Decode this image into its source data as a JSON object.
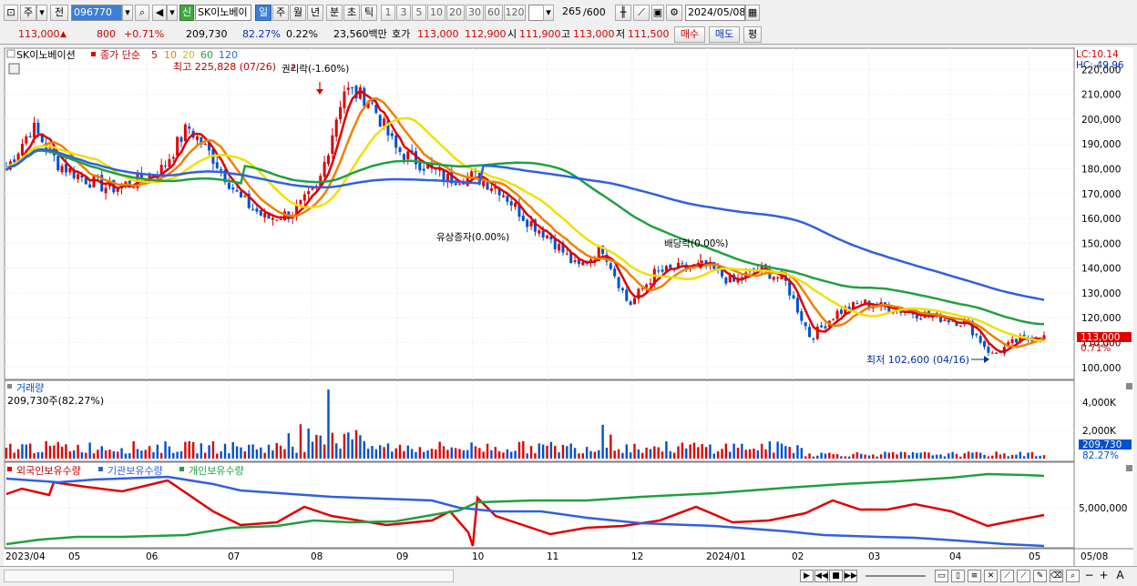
{
  "toolbar": {
    "period_unit": "주",
    "prev_label": "전",
    "code": "096770",
    "badge": "신",
    "stock_name": "SK이노베이",
    "intervals": [
      "일",
      "주",
      "월",
      "년",
      "분",
      "초",
      "틱"
    ],
    "selected_interval": "일",
    "counts": [
      "1",
      "3",
      "5",
      "10",
      "20",
      "30",
      "60",
      "120"
    ],
    "bar_count": "265",
    "bar_total": "/600",
    "date": "2024/05/08"
  },
  "quote": {
    "price": "113,000",
    "change": "800",
    "change_pct": "+0.71%",
    "volume": "209,730",
    "vol_ratio": "82.27%",
    "turnover_pct": "0.22%",
    "amount": "23,560백만",
    "hoga_label": "호가",
    "ask": "113,000",
    "bid": "112,900",
    "open_label": "시",
    "open": "111,900",
    "high_label": "고",
    "high": "113,000",
    "low_label": "저",
    "low": "111,500",
    "buy_label": "매수",
    "sell_label": "매도",
    "eval_label": "평"
  },
  "legend": {
    "name": "SK이노베이션",
    "price_label": "종가 단순",
    "ma_periods": [
      "5",
      "10",
      "20",
      "60",
      "120"
    ],
    "high_note": "최고 225,828 (07/26)",
    "low_note": "최저 102,600 (04/16)",
    "lc": "LC:10.14",
    "hc": "HC:-49.96",
    "last_price": "113,000",
    "last_pct": "0.71%",
    "vol_title": "거래량",
    "vol_value": "209,730주(82.27%)",
    "vol_last": "209,730",
    "vol_last_pct": "82.27%",
    "inv_foreign": "외국인보유수량",
    "inv_inst": "기관보유수량",
    "inv_indiv": "개인보유수량"
  },
  "colors": {
    "up": "#e00000",
    "down": "#0050d0",
    "ma5": "#e00000",
    "ma10": "#f08000",
    "ma20": "#f0e000",
    "ma60": "#20a040",
    "ma120": "#3060e0"
  },
  "chart_data": [
    {
      "type": "candlestick",
      "title": "SK이노베이션",
      "x_labels": [
        "2023/04",
        "05",
        "06",
        "07",
        "08",
        "09",
        "10",
        "11",
        "12",
        "2024/01",
        "02",
        "03",
        "04",
        "05",
        "05/08"
      ],
      "ylim": [
        97000,
        226000
      ],
      "yticks": [
        100000,
        110000,
        120000,
        130000,
        140000,
        150000,
        160000,
        170000,
        180000,
        190000,
        200000,
        210000,
        220000
      ],
      "price_path": [
        180000,
        197000,
        182000,
        176000,
        172000,
        175000,
        180000,
        197000,
        184000,
        168000,
        160000,
        162000,
        172000,
        212000,
        208000,
        188000,
        182000,
        176000,
        177000,
        172000,
        160000,
        152000,
        140000,
        148000,
        125000,
        138000,
        140000,
        141000,
        134000,
        140000,
        135000,
        112000,
        122000,
        126000,
        124000,
        122000,
        120000,
        118000,
        105000,
        111000,
        113000
      ],
      "annotations": [
        {
          "text": "권리락(-1.60%)",
          "x": "2023/08/01"
        },
        {
          "text": "유상증자(0.00%)",
          "x": "2023/10/05"
        },
        {
          "text": "배당락(0.00%)",
          "x": "2023/12/27"
        }
      ],
      "series": [
        {
          "name": "5",
          "color": "#e00000"
        },
        {
          "name": "10",
          "color": "#f08000"
        },
        {
          "name": "20",
          "color": "#f0e000"
        },
        {
          "name": "60",
          "color": "#20a040"
        },
        {
          "name": "120",
          "color": "#3060e0"
        }
      ]
    },
    {
      "type": "bar",
      "title": "거래량",
      "yticks": [
        "2,000K",
        "4,000K"
      ],
      "last": 209730
    },
    {
      "type": "line",
      "ytick": "5,000,000",
      "series": [
        {
          "name": "외국인보유수량",
          "color": "#e00000"
        },
        {
          "name": "기관보유수량",
          "color": "#3060e0"
        },
        {
          "name": "개인보유수량",
          "color": "#20a040"
        }
      ]
    }
  ]
}
